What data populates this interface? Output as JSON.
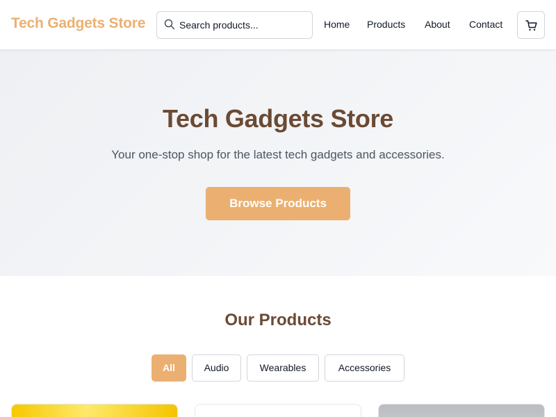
{
  "header": {
    "logo": "Tech Gadgets Store",
    "search": {
      "placeholder": "Search products...",
      "icon": "search-icon"
    },
    "nav": [
      "Home",
      "Products",
      "About",
      "Contact"
    ],
    "cart_icon": "shopping-cart-icon"
  },
  "hero": {
    "title": "Tech Gadgets Store",
    "subtitle": "Your one-stop shop for the latest tech gadgets and accessories.",
    "button": "Browse Products"
  },
  "products": {
    "title": "Our Products",
    "filters": [
      "All",
      "Audio",
      "Wearables",
      "Accessories"
    ],
    "active_filter": "All"
  },
  "colors": {
    "accent": "#ebb071",
    "heading": "#6b4a34",
    "hero_bg": "#f1f3f6"
  }
}
